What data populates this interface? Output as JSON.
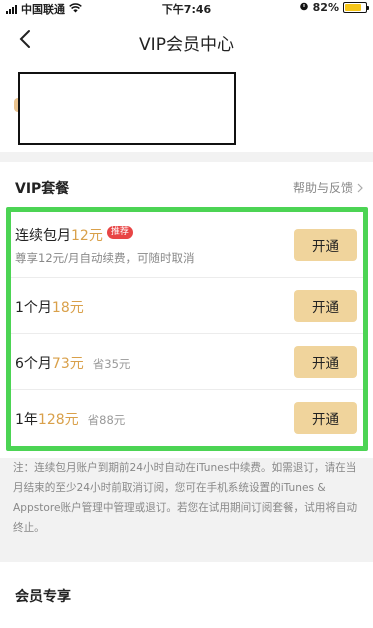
{
  "status_bar": {
    "carrier": "中国联通",
    "time": "下午7:46",
    "battery_percent": "82%",
    "battery_level": 0.82
  },
  "nav": {
    "title": "VIP会员中心"
  },
  "vip": {
    "section_title": "VIP套餐",
    "help_link": "帮助与反馈",
    "plans": [
      {
        "name_prefix": "连续包月",
        "price": "12元",
        "badge": "推荐",
        "subtitle": "尊享12元/月自动续费，可随时取消",
        "button": "开通"
      },
      {
        "name_prefix": "1个月",
        "price": "18元",
        "button": "开通"
      },
      {
        "name_prefix": "6个月",
        "price": "73元",
        "save": "省35元",
        "button": "开通"
      },
      {
        "name_prefix": "1年",
        "price": "128元",
        "save": "省88元",
        "button": "开通"
      }
    ]
  },
  "note": "注：连续包月账户到期前24小时自动在iTunes中续费。如需退订，请在当月结束的至少24小时前取消订阅，您可在手机系统设置的iTunes & Appstore账户管理中管理或退订。若您在试用期间订阅套餐，试用将自动终止。",
  "members": {
    "section_title": "会员专享"
  },
  "colors": {
    "accent_price": "#d9a04a",
    "button_bg": "#f0d49c",
    "badge_bg": "#e84545",
    "highlight_border": "#4cd454"
  }
}
